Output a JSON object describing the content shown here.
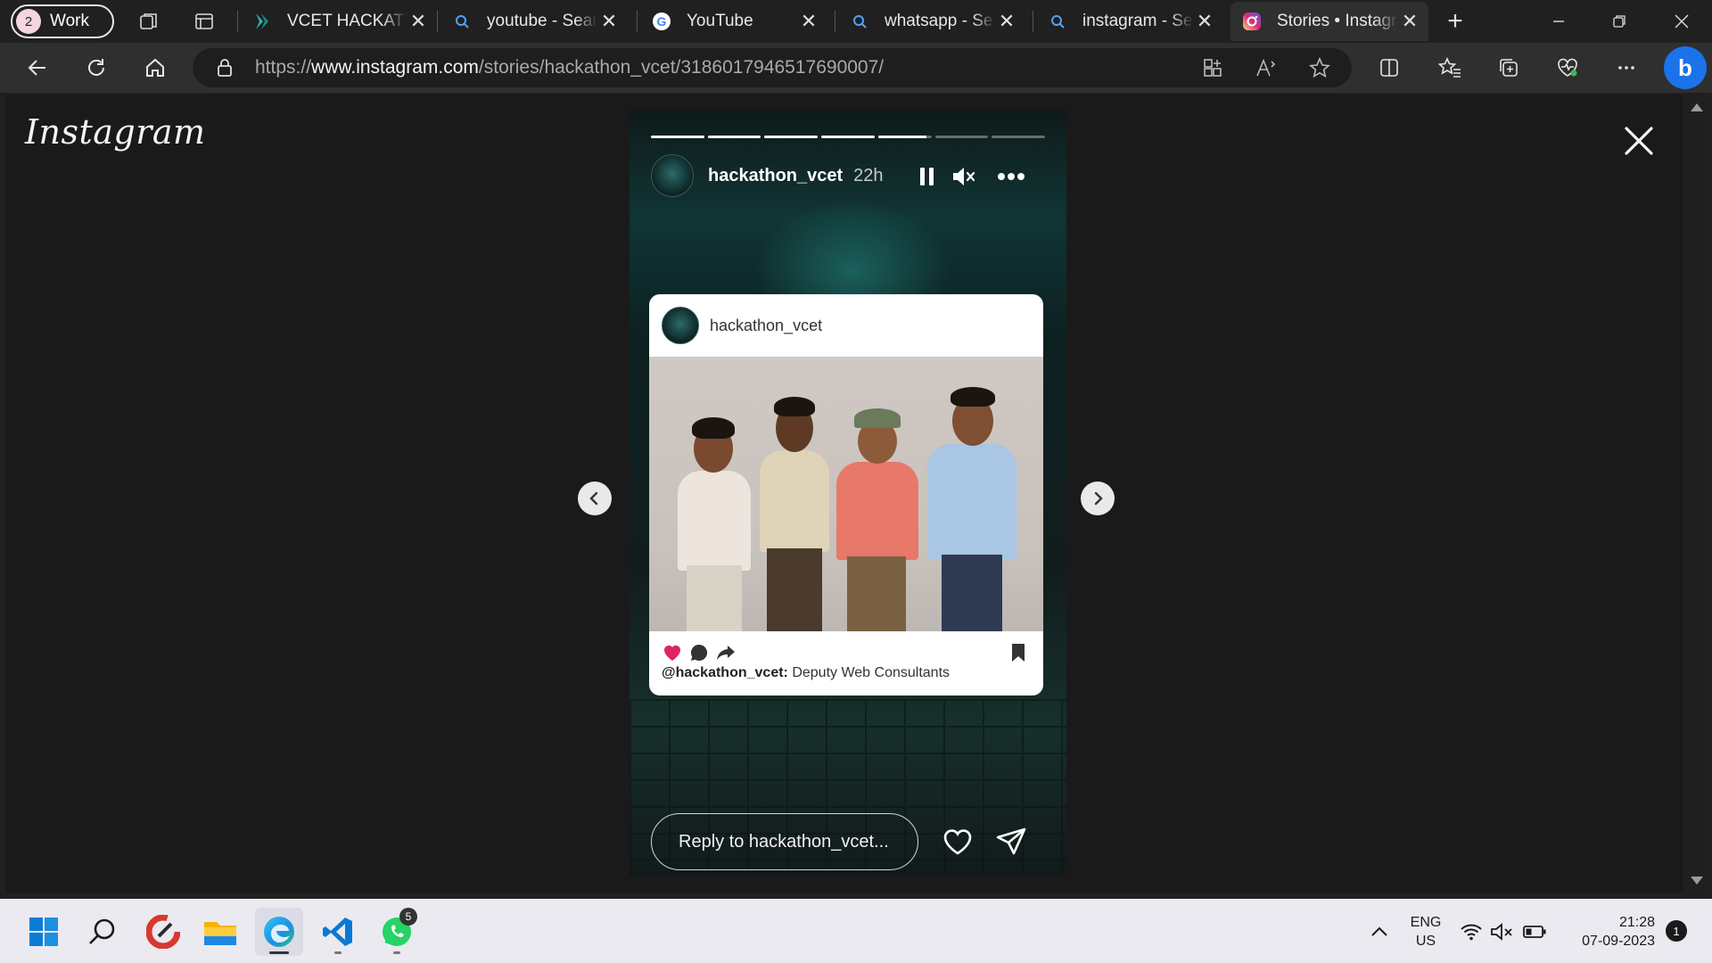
{
  "browser": {
    "workspace": {
      "count": "2",
      "label": "Work"
    },
    "tabs": [
      {
        "title": "VCET HACKATHON",
        "favicon": "vcet-icon"
      },
      {
        "title": "youtube - Search",
        "favicon": "search-icon"
      },
      {
        "title": "YouTube",
        "favicon": "google-icon"
      },
      {
        "title": "whatsapp - Search",
        "favicon": "search-icon"
      },
      {
        "title": "instagram - Search",
        "favicon": "search-icon"
      },
      {
        "title": "Stories • Instagram",
        "favicon": "instagram-icon",
        "active": true
      }
    ],
    "address": {
      "scheme": "https://",
      "host": "www.instagram.com",
      "path": "/stories/hackathon_vcet/3186017946517690007/"
    }
  },
  "page": {
    "logo": "Instagram",
    "story": {
      "username": "hackathon_vcet",
      "time_ago": "22h",
      "progress": [
        1,
        1,
        1,
        1,
        0.9,
        0,
        0
      ],
      "post": {
        "username": "hackathon_vcet",
        "caption_user": "@hackathon_vcet:",
        "caption_text": "Deputy Web Consultants"
      },
      "reply_placeholder": "Reply to hackathon_vcet..."
    }
  },
  "taskbar": {
    "apps": [
      "windows-start-icon",
      "search-icon",
      "ccleaner-icon",
      "file-explorer-icon",
      "edge-icon",
      "vscode-icon",
      "whatsapp-icon"
    ],
    "whatsapp_badge": "5",
    "lang_top": "ENG",
    "lang_bottom": "US",
    "time": "21:28",
    "date": "07-09-2023",
    "notifications": "1"
  },
  "colors": {
    "accent": "#1a73e8",
    "heart": "#e0245e",
    "instagram_gradient": "#dd2a7b"
  }
}
